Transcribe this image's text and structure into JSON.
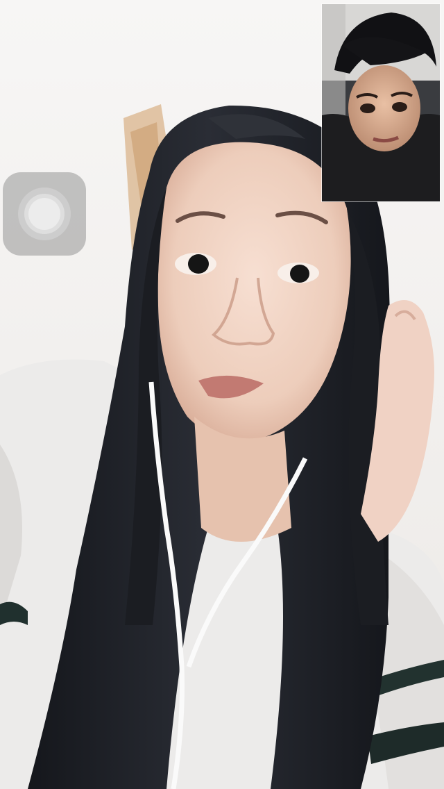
{
  "screen": {
    "type": "video-call"
  },
  "remote_video": {
    "icon": "person-video-feed",
    "description_visible": false
  },
  "local_preview": {
    "icon": "self-camera-preview"
  },
  "assistive_touch": {
    "icon": "assistive-touch-icon"
  },
  "colors": {
    "hair": "#1c1e24",
    "sweater": "#ecebea",
    "sweater_stripe": "#20302e",
    "skin": "#efd3c4",
    "wall": "#f1efed"
  }
}
